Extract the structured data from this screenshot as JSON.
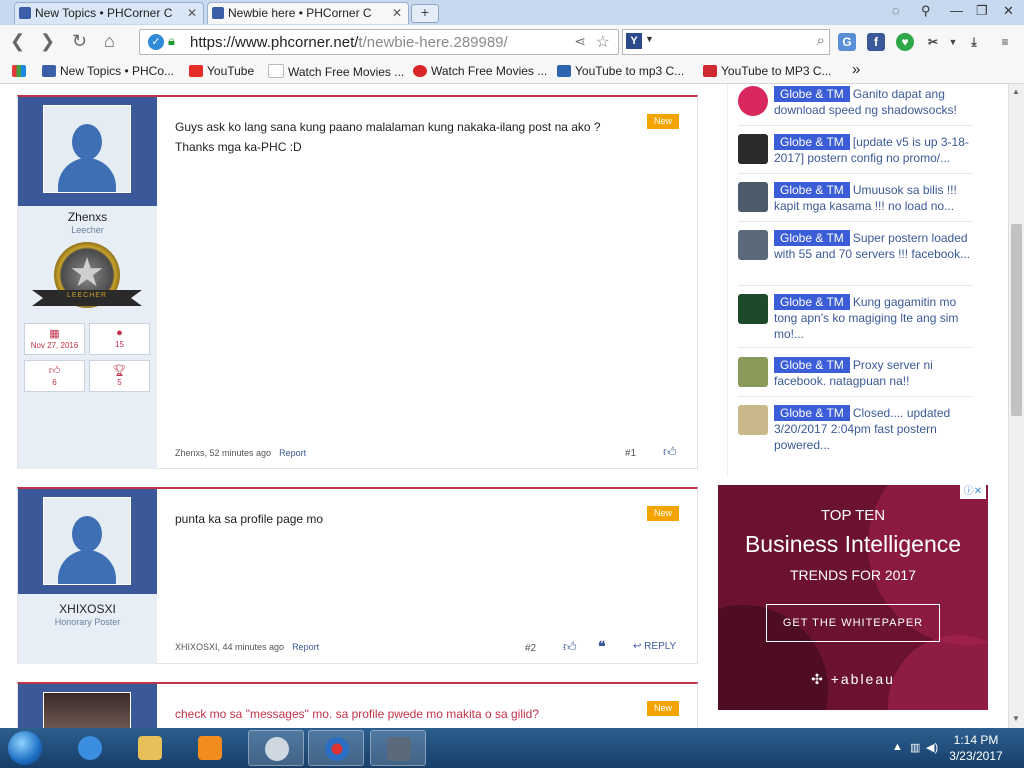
{
  "browser": {
    "tabs": [
      {
        "label": "New Topics • PHCorner C",
        "active": false
      },
      {
        "label": "Newbie here • PHCorner C",
        "active": true
      }
    ],
    "url_host": "https://www.phcorner.net/",
    "url_path": "t/newbie-here.289989/",
    "search_engine_icon": "Y",
    "bookmarks": [
      {
        "label": "New Topics • PHCo...",
        "color": "#3a5fa8"
      },
      {
        "label": "YouTube",
        "color": "#e52d27"
      },
      {
        "label": "Watch Free Movies ...",
        "color": "#888888"
      },
      {
        "label": "Watch Free Movies ...",
        "color": "#d8262b"
      },
      {
        "label": "YouTube to mp3 C...",
        "color": "#2c64b0"
      },
      {
        "label": "YouTube to MP3 C...",
        "color": "#cf2a30"
      }
    ],
    "bookmarks_more": "»"
  },
  "posts": [
    {
      "username": "Zhenxs",
      "user_title": "Leecher",
      "badge_label": "LEECHER",
      "stats": {
        "joined": "Nov 27, 2016",
        "messages": "15",
        "likes": "6",
        "trophies": "5"
      },
      "message": "Guys ask ko lang sana kung paano malalaman kung nakaka-ilang post na ako ?\nThanks mga ka-PHC :D",
      "new_label": "New",
      "meta": "Zhenxs, 52 minutes ago",
      "report_label": "Report",
      "number": "#1"
    },
    {
      "username": "XHIXOSXI",
      "user_title": "Honorary Poster",
      "message": "punta ka sa profile page mo",
      "new_label": "New",
      "meta": "XHIXOSXI, 44 minutes ago",
      "report_label": "Report",
      "number": "#2",
      "reply_label": "REPLY"
    },
    {
      "message": "check mo sa \"messages\" mo. sa profile pwede mo makita o sa gilid?",
      "new_label": "New"
    }
  ],
  "sidebar": {
    "items": [
      {
        "tag": "Globe & TM",
        "title": "Ganito dapat ang download speed ng shadowsocks!",
        "thumb_color": "#d8285e"
      },
      {
        "tag": "Globe & TM",
        "title": "[update v5 is up 3-18-2017] postern config no promo/...",
        "thumb_color": "#2a2a2a"
      },
      {
        "tag": "Globe & TM",
        "title": "Umuusok sa bilis !!! kapit mga kasama !!! no load no...",
        "thumb_color": "#4d5a6a"
      },
      {
        "tag": "Globe & TM",
        "title": "Super postern loaded with 55 and 70 servers !!! facebook...",
        "thumb_color": "#5a6a7a"
      },
      {
        "tag": "Globe & TM",
        "title": "Kung gagamitin mo tong apn's ko magiging lte ang sim mo!...",
        "thumb_color": "#1d4a2a"
      },
      {
        "tag": "Globe & TM",
        "title": "Proxy server ni facebook. natagpuan na!!",
        "thumb_color": "#8a9a5a"
      },
      {
        "tag": "Globe & TM",
        "title": "Closed.... updated 3/20/2017 2:04pm fast postern powered...",
        "thumb_color": "#c9b98a"
      }
    ]
  },
  "ad": {
    "line1": "TOP TEN",
    "line2": "Business Intelligence",
    "line3": "TRENDS FOR 2017",
    "cta": "GET THE WHITEPAPER",
    "logo": "+ableau"
  },
  "taskbar": {
    "time": "1:14 PM",
    "date": "3/23/2017"
  }
}
